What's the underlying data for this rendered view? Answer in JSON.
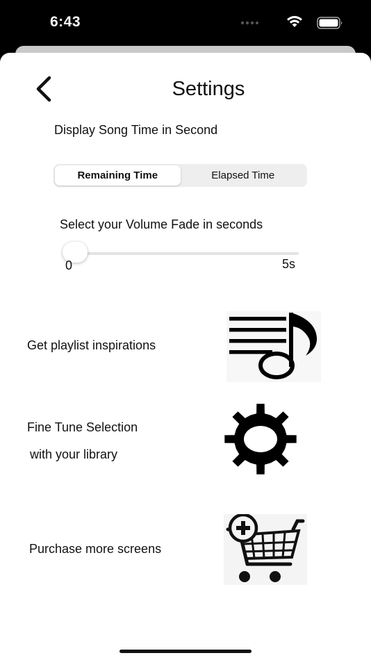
{
  "status_bar": {
    "time": "6:43"
  },
  "header": {
    "title": "Settings"
  },
  "song_time": {
    "label": "Display Song Time in Second",
    "options": [
      "Remaining Time",
      "Elapsed Time"
    ],
    "selected": "Remaining Time"
  },
  "volume_fade": {
    "label": "Select your Volume Fade in seconds",
    "min_label": "0",
    "max_label": "5s",
    "value": 0,
    "min": 0,
    "max": 5
  },
  "rows": {
    "playlist": {
      "label": "Get playlist inspirations",
      "icon": "music-note-list-icon"
    },
    "fine_tune": {
      "label_line1": "Fine Tune Selection",
      "label_line2": "with your library",
      "icon": "gear-icon"
    },
    "purchase": {
      "label": "Purchase more screens",
      "icon": "shopping-cart-add-icon"
    }
  },
  "colors": {
    "background": "#000000",
    "sheet": "#ffffff",
    "segment_bg": "#eeeeef",
    "text": "#111111"
  }
}
